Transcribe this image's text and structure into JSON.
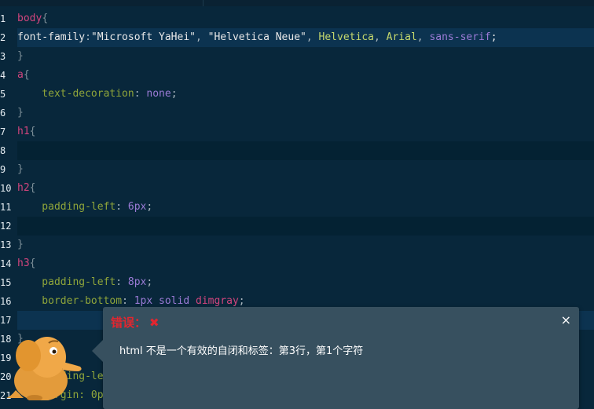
{
  "editor": {
    "lines": [
      {
        "n": "1",
        "code": "body{"
      },
      {
        "n": "2",
        "code": "font-family:\"Microsoft YaHei\", \"Helvetica Neue\", Helvetica, Arial, sans-serif;"
      },
      {
        "n": "3",
        "code": "}"
      },
      {
        "n": "4",
        "code": "a{"
      },
      {
        "n": "5",
        "code": "    text-decoration: none;"
      },
      {
        "n": "6",
        "code": "}"
      },
      {
        "n": "7",
        "code": "h1{"
      },
      {
        "n": "8",
        "code": ""
      },
      {
        "n": "9",
        "code": "}"
      },
      {
        "n": "10",
        "code": "h2{"
      },
      {
        "n": "11",
        "code": "    padding-left: 6px;"
      },
      {
        "n": "12",
        "code": ""
      },
      {
        "n": "13",
        "code": "}"
      },
      {
        "n": "14",
        "code": "h3{"
      },
      {
        "n": "15",
        "code": "    padding-left: 8px;"
      },
      {
        "n": "16",
        "code": "    border-bottom: 1px solid dimgray;"
      },
      {
        "n": "17",
        "code": ""
      },
      {
        "n": "18",
        "code": "}"
      },
      {
        "n": "19",
        "code": ""
      },
      {
        "n": "20",
        "code": "    padding-le"
      },
      {
        "n": "21",
        "code": "    margin: 0p"
      }
    ]
  },
  "error_panel": {
    "title": "错误：",
    "title_icon": "cross-icon",
    "close_label": "×",
    "message": "html 不是一个有效的自闭和标签：第3行，第1个字符"
  },
  "colors": {
    "editor_bg": "#08273b",
    "panel_bg": "#37505f",
    "error_red": "#e3262f"
  }
}
